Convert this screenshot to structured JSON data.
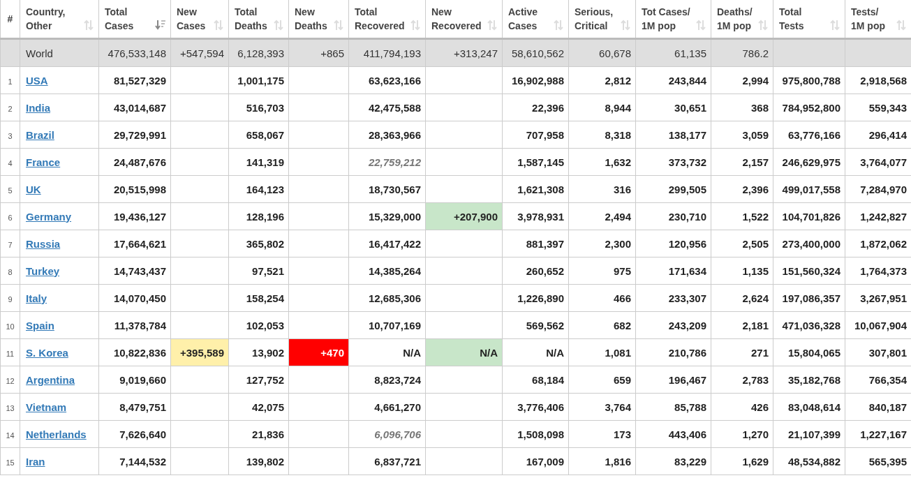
{
  "columns": [
    {
      "label": "#"
    },
    {
      "label": "Country,\nOther",
      "sortable": true,
      "sorted": false
    },
    {
      "label": "Total\nCases",
      "sortable": true,
      "sorted": true
    },
    {
      "label": "New\nCases",
      "sortable": true,
      "sorted": false
    },
    {
      "label": "Total\nDeaths",
      "sortable": true,
      "sorted": false
    },
    {
      "label": "New\nDeaths",
      "sortable": true,
      "sorted": false
    },
    {
      "label": "Total\nRecovered",
      "sortable": true,
      "sorted": false
    },
    {
      "label": "New\nRecovered",
      "sortable": true,
      "sorted": false
    },
    {
      "label": "Active\nCases",
      "sortable": true,
      "sorted": false
    },
    {
      "label": "Serious,\nCritical",
      "sortable": true,
      "sorted": false
    },
    {
      "label": "Tot Cases/\n1M pop",
      "sortable": true,
      "sorted": false
    },
    {
      "label": "Deaths/\n1M pop",
      "sortable": true,
      "sorted": false
    },
    {
      "label": "Total\nTests",
      "sortable": true,
      "sorted": false
    },
    {
      "label": "Tests/\n1M pop",
      "sortable": true,
      "sorted": false
    }
  ],
  "world": {
    "country": "World",
    "total_cases": "476,533,148",
    "new_cases": "+547,594",
    "total_deaths": "6,128,393",
    "new_deaths": "+865",
    "total_recovered": "411,794,193",
    "new_recovered": "+313,247",
    "active_cases": "58,610,562",
    "serious": "60,678",
    "cases_per_m": "61,135",
    "deaths_per_m": "786.2"
  },
  "rows": [
    {
      "rank": "1",
      "country": "USA",
      "total_cases": "81,527,329",
      "total_deaths": "1,001,175",
      "total_recovered": "63,623,166",
      "recovered_estimated": false,
      "active_cases": "16,902,988",
      "serious": "2,812",
      "cases_per_m": "243,844",
      "deaths_per_m": "2,994",
      "total_tests": "975,800,788",
      "tests_per_m": "2,918,568"
    },
    {
      "rank": "2",
      "country": "India",
      "total_cases": "43,014,687",
      "total_deaths": "516,703",
      "total_recovered": "42,475,588",
      "recovered_estimated": false,
      "active_cases": "22,396",
      "serious": "8,944",
      "cases_per_m": "30,651",
      "deaths_per_m": "368",
      "total_tests": "784,952,800",
      "tests_per_m": "559,343"
    },
    {
      "rank": "3",
      "country": "Brazil",
      "total_cases": "29,729,991",
      "total_deaths": "658,067",
      "total_recovered": "28,363,966",
      "recovered_estimated": false,
      "active_cases": "707,958",
      "serious": "8,318",
      "cases_per_m": "138,177",
      "deaths_per_m": "3,059",
      "total_tests": "63,776,166",
      "tests_per_m": "296,414"
    },
    {
      "rank": "4",
      "country": "France",
      "total_cases": "24,487,676",
      "total_deaths": "141,319",
      "total_recovered": "22,759,212",
      "recovered_estimated": true,
      "active_cases": "1,587,145",
      "serious": "1,632",
      "cases_per_m": "373,732",
      "deaths_per_m": "2,157",
      "total_tests": "246,629,975",
      "tests_per_m": "3,764,077"
    },
    {
      "rank": "5",
      "country": "UK",
      "total_cases": "20,515,998",
      "total_deaths": "164,123",
      "total_recovered": "18,730,567",
      "recovered_estimated": false,
      "active_cases": "1,621,308",
      "serious": "316",
      "cases_per_m": "299,505",
      "deaths_per_m": "2,396",
      "total_tests": "499,017,558",
      "tests_per_m": "7,284,970"
    },
    {
      "rank": "6",
      "country": "Germany",
      "total_cases": "19,436,127",
      "total_deaths": "128,196",
      "total_recovered": "15,329,000",
      "recovered_estimated": false,
      "new_recovered": "+207,900",
      "active_cases": "3,978,931",
      "serious": "2,494",
      "cases_per_m": "230,710",
      "deaths_per_m": "1,522",
      "total_tests": "104,701,826",
      "tests_per_m": "1,242,827"
    },
    {
      "rank": "7",
      "country": "Russia",
      "total_cases": "17,664,621",
      "total_deaths": "365,802",
      "total_recovered": "16,417,422",
      "recovered_estimated": false,
      "active_cases": "881,397",
      "serious": "2,300",
      "cases_per_m": "120,956",
      "deaths_per_m": "2,505",
      "total_tests": "273,400,000",
      "tests_per_m": "1,872,062"
    },
    {
      "rank": "8",
      "country": "Turkey",
      "total_cases": "14,743,437",
      "total_deaths": "97,521",
      "total_recovered": "14,385,264",
      "recovered_estimated": false,
      "active_cases": "260,652",
      "serious": "975",
      "cases_per_m": "171,634",
      "deaths_per_m": "1,135",
      "total_tests": "151,560,324",
      "tests_per_m": "1,764,373"
    },
    {
      "rank": "9",
      "country": "Italy",
      "total_cases": "14,070,450",
      "total_deaths": "158,254",
      "total_recovered": "12,685,306",
      "recovered_estimated": false,
      "active_cases": "1,226,890",
      "serious": "466",
      "cases_per_m": "233,307",
      "deaths_per_m": "2,624",
      "total_tests": "197,086,357",
      "tests_per_m": "3,267,951"
    },
    {
      "rank": "10",
      "country": "Spain",
      "total_cases": "11,378,784",
      "total_deaths": "102,053",
      "total_recovered": "10,707,169",
      "recovered_estimated": false,
      "active_cases": "569,562",
      "serious": "682",
      "cases_per_m": "243,209",
      "deaths_per_m": "2,181",
      "total_tests": "471,036,328",
      "tests_per_m": "10,067,904"
    },
    {
      "rank": "11",
      "country": "S. Korea",
      "total_cases": "10,822,836",
      "new_cases": "+395,589",
      "total_deaths": "13,902",
      "new_deaths": "+470",
      "total_recovered": "N/A",
      "recovered_estimated": false,
      "new_recovered": "N/A",
      "active_cases": "N/A",
      "serious": "1,081",
      "cases_per_m": "210,786",
      "deaths_per_m": "271",
      "total_tests": "15,804,065",
      "tests_per_m": "307,801"
    },
    {
      "rank": "12",
      "country": "Argentina",
      "total_cases": "9,019,660",
      "total_deaths": "127,752",
      "total_recovered": "8,823,724",
      "recovered_estimated": false,
      "active_cases": "68,184",
      "serious": "659",
      "cases_per_m": "196,467",
      "deaths_per_m": "2,783",
      "total_tests": "35,182,768",
      "tests_per_m": "766,354"
    },
    {
      "rank": "13",
      "country": "Vietnam",
      "total_cases": "8,479,751",
      "total_deaths": "42,075",
      "total_recovered": "4,661,270",
      "recovered_estimated": false,
      "active_cases": "3,776,406",
      "serious": "3,764",
      "cases_per_m": "85,788",
      "deaths_per_m": "426",
      "total_tests": "83,048,614",
      "tests_per_m": "840,187"
    },
    {
      "rank": "14",
      "country": "Netherlands",
      "total_cases": "7,626,640",
      "total_deaths": "21,836",
      "total_recovered": "6,096,706",
      "recovered_estimated": true,
      "active_cases": "1,508,098",
      "serious": "173",
      "cases_per_m": "443,406",
      "deaths_per_m": "1,270",
      "total_tests": "21,107,399",
      "tests_per_m": "1,227,167"
    },
    {
      "rank": "15",
      "country": "Iran",
      "total_cases": "7,144,532",
      "total_deaths": "139,802",
      "total_recovered": "6,837,721",
      "recovered_estimated": false,
      "active_cases": "167,009",
      "serious": "1,816",
      "cases_per_m": "83,229",
      "deaths_per_m": "1,629",
      "total_tests": "48,534,882",
      "tests_per_m": "565,395"
    }
  ]
}
